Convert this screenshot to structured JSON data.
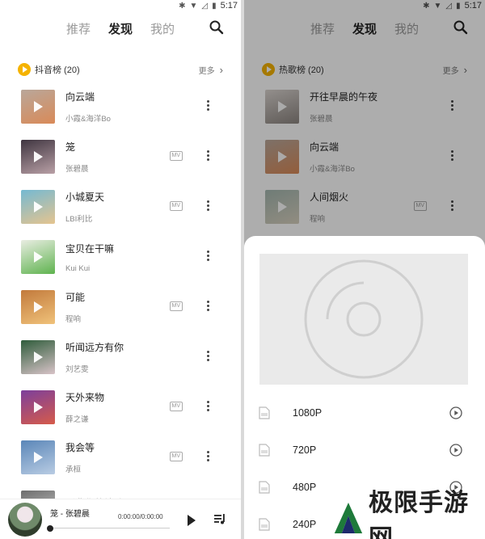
{
  "status": {
    "time": "5:17"
  },
  "left": {
    "tabs": [
      {
        "label": "推荐",
        "active": false
      },
      {
        "label": "发现",
        "active": true
      },
      {
        "label": "我的",
        "active": false
      }
    ],
    "section": {
      "title": "抖音榜 (20)",
      "more": "更多"
    },
    "songs": [
      {
        "title": "向云端",
        "artist": "小霞&海洋Bo",
        "mv": false,
        "cover": [
          "#b9a79a",
          "#d98a58"
        ]
      },
      {
        "title": "笼",
        "artist": "张碧晨",
        "mv": true,
        "cover": [
          "#3f3540",
          "#b9a0a6"
        ]
      },
      {
        "title": "小城夏天",
        "artist": "LBI利比",
        "mv": true,
        "cover": [
          "#75b9d2",
          "#e5c48f"
        ]
      },
      {
        "title": "宝贝在干嘛",
        "artist": "Kui Kui",
        "mv": false,
        "cover": [
          "#e9ede2",
          "#5fb34f"
        ]
      },
      {
        "title": "可能",
        "artist": "程响",
        "mv": true,
        "cover": [
          "#c27a3c",
          "#f0c27a"
        ]
      },
      {
        "title": "听闻远方有你",
        "artist": "刘艺雯",
        "mv": false,
        "cover": [
          "#2f5c3b",
          "#d8c3c8"
        ]
      },
      {
        "title": "天外来物",
        "artist": "薛之谦",
        "mv": true,
        "cover": [
          "#7c3f9c",
          "#d65b4a"
        ]
      },
      {
        "title": "我会等",
        "artist": "承桓",
        "mv": true,
        "cover": [
          "#5a86b8",
          "#b9cce3"
        ]
      },
      {
        "title": "听悲伤的情歌",
        "artist": "",
        "mv": false,
        "cover": [
          "#6d6d6d",
          "#cfcfcf"
        ]
      }
    ],
    "player": {
      "title": "笼 - 张碧晨",
      "time": "0:00:00/0:00:00"
    }
  },
  "right": {
    "tabs": [
      {
        "label": "推荐",
        "active": false
      },
      {
        "label": "发现",
        "active": true
      },
      {
        "label": "我的",
        "active": false
      }
    ],
    "section": {
      "title": "热歌榜 (20)",
      "more": "更多"
    },
    "songs": [
      {
        "title": "开往早晨的午夜",
        "artist": "张碧晨",
        "mv": false,
        "cover": [
          "#d9d3cf",
          "#8c8580"
        ]
      },
      {
        "title": "向云端",
        "artist": "小霞&海洋Bo",
        "mv": false,
        "cover": [
          "#b9a79a",
          "#d98a58"
        ]
      },
      {
        "title": "人间烟火",
        "artist": "程响",
        "mv": true,
        "cover": [
          "#a4b7b0",
          "#d7d0be"
        ]
      }
    ],
    "sheet": {
      "resolutions": [
        {
          "label": "1080P"
        },
        {
          "label": "720P"
        },
        {
          "label": "480P"
        },
        {
          "label": "240P"
        }
      ]
    }
  },
  "watermark": {
    "text": "极限手游网"
  },
  "colors": {
    "badge": "#f5b300",
    "overlay": "rgba(0,0,0,0.32)"
  }
}
